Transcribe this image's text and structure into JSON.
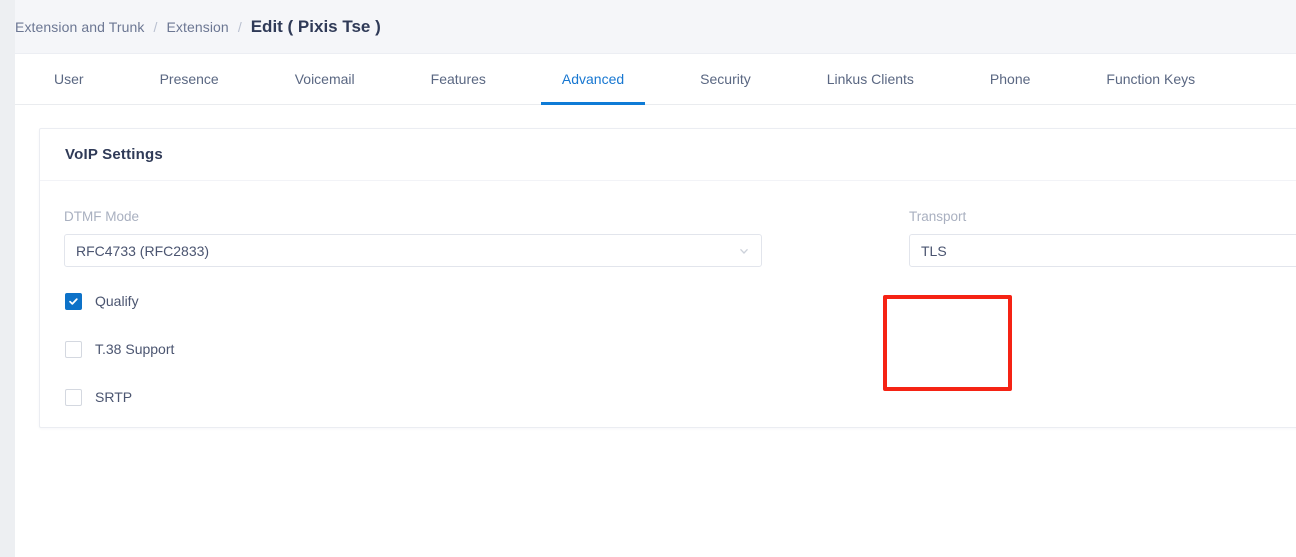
{
  "breadcrumb": {
    "items": [
      {
        "label": "Extension and Trunk",
        "current": false
      },
      {
        "label": "Extension",
        "current": false
      }
    ],
    "separator": "/",
    "current": "Edit ( Pixis Tse )"
  },
  "tabs": [
    {
      "label": "User",
      "active": false
    },
    {
      "label": "Presence",
      "active": false
    },
    {
      "label": "Voicemail",
      "active": false
    },
    {
      "label": "Features",
      "active": false
    },
    {
      "label": "Advanced",
      "active": true
    },
    {
      "label": "Security",
      "active": false
    },
    {
      "label": "Linkus Clients",
      "active": false
    },
    {
      "label": "Phone",
      "active": false
    },
    {
      "label": "Function Keys",
      "active": false
    }
  ],
  "panel": {
    "title": "VoIP Settings",
    "fields": {
      "dtmf_mode": {
        "label": "DTMF Mode",
        "value": "RFC4733 (RFC2833)",
        "control": "dropdown",
        "icon": "chevron-down-icon"
      },
      "transport": {
        "label": "Transport",
        "value": "TLS",
        "control": "text"
      }
    },
    "checkboxes": [
      {
        "label": "Qualify",
        "checked": true
      },
      {
        "label": "T.38 Support",
        "checked": false
      },
      {
        "label": "SRTP",
        "checked": false
      }
    ]
  },
  "annotation": {
    "type": "highlight-rectangle",
    "color": "#f52314",
    "target": "transport"
  },
  "colors": {
    "accent": "#1777d1",
    "tab_underline": "#0e7bd6",
    "checkbox_checked": "#0d72c8",
    "annotation": "#f52314",
    "header_bg": "#f5f6f9",
    "label_text": "#a9b0c0",
    "title_text": "#2f3a57"
  }
}
